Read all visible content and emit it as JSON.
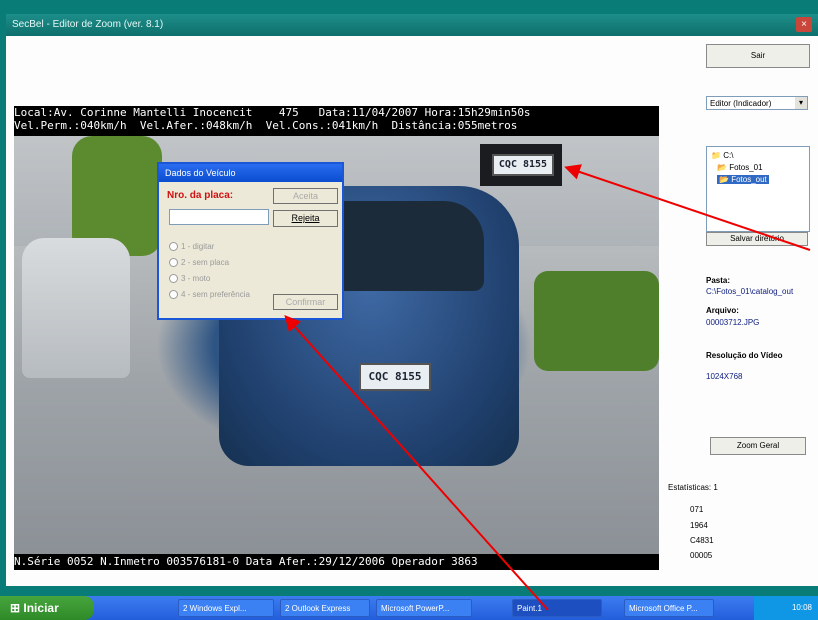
{
  "window": {
    "title": "SecBel - Editor de Zoom (ver. 8.1)",
    "close": "×"
  },
  "overlay": {
    "top_line1": "Local:Av. Corinne Mantelli Inocencit    475   Data:11/04/2007 Hora:15h29min50s",
    "top_line2": "Vel.Perm.:040km/h  Vel.Afer.:048km/h  Vel.Cons.:041km/h  Distância:055metros",
    "bottom_line": "N.Série 0052 N.Inmetro 003576181-0 Data Afer.:29/12/2006 Operador 3863"
  },
  "plates": {
    "crop": "CQC 8155",
    "front": "CQC 8155"
  },
  "dialog": {
    "title": "Dados do Veículo",
    "label": "Nro. da placa:",
    "accept": "Aceita",
    "reject": "Rejeita",
    "options": [
      "1 - digitar",
      "2 - sem placa",
      "3 - moto",
      "4 - sem preferência"
    ],
    "confirm": "Confirmar"
  },
  "side": {
    "top_button": "Sair",
    "combo": "Editor (Indicador)",
    "tree": [
      "C:\\",
      "Fotos_01",
      "Fotos_out"
    ],
    "tree_button": "Salvar diretório",
    "path_label": "Pasta:",
    "path_value": "C:\\Fotos_01\\catalog_out",
    "file_label": "Arquivo:",
    "file_value": "00003712.JPG",
    "res_label": "Resolução do Vídeo",
    "res_value": "1024X768",
    "zoom_button": "Zoom Geral",
    "stats_label": "Estatísticas: 1",
    "stats": [
      "071",
      "1964",
      "C4831",
      "00005"
    ]
  },
  "taskbar": {
    "start": "Iniciar",
    "items": [
      "2 Windows Expl...",
      "2 Outlook Express",
      "Microsoft PowerP...",
      "Paint.1",
      "Microsoft Office P..."
    ],
    "clock": "10:08"
  }
}
